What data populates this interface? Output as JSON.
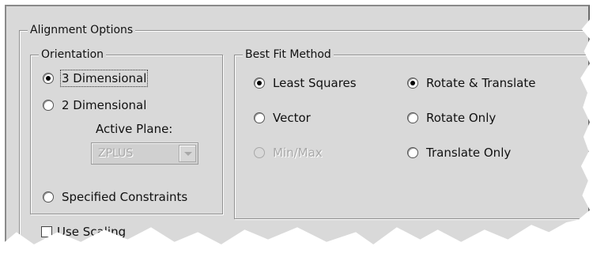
{
  "alignment": {
    "title": "Alignment Options",
    "orientation": {
      "title": "Orientation",
      "options": [
        "3 Dimensional",
        "2 Dimensional",
        "Specified Constraints"
      ],
      "selected": "3 Dimensional",
      "active_plane_label": "Active Plane:",
      "active_plane_value": "ZPLUS"
    },
    "best_fit": {
      "title": "Best Fit Method",
      "method_options": [
        "Least Squares",
        "Vector",
        "Min/Max"
      ],
      "method_selected": "Least Squares",
      "mode_options": [
        "Rotate & Translate",
        "Rotate Only",
        "Translate Only"
      ],
      "mode_selected": "Rotate & Translate"
    },
    "scaling_checkbox_label": "Use Scaling"
  }
}
